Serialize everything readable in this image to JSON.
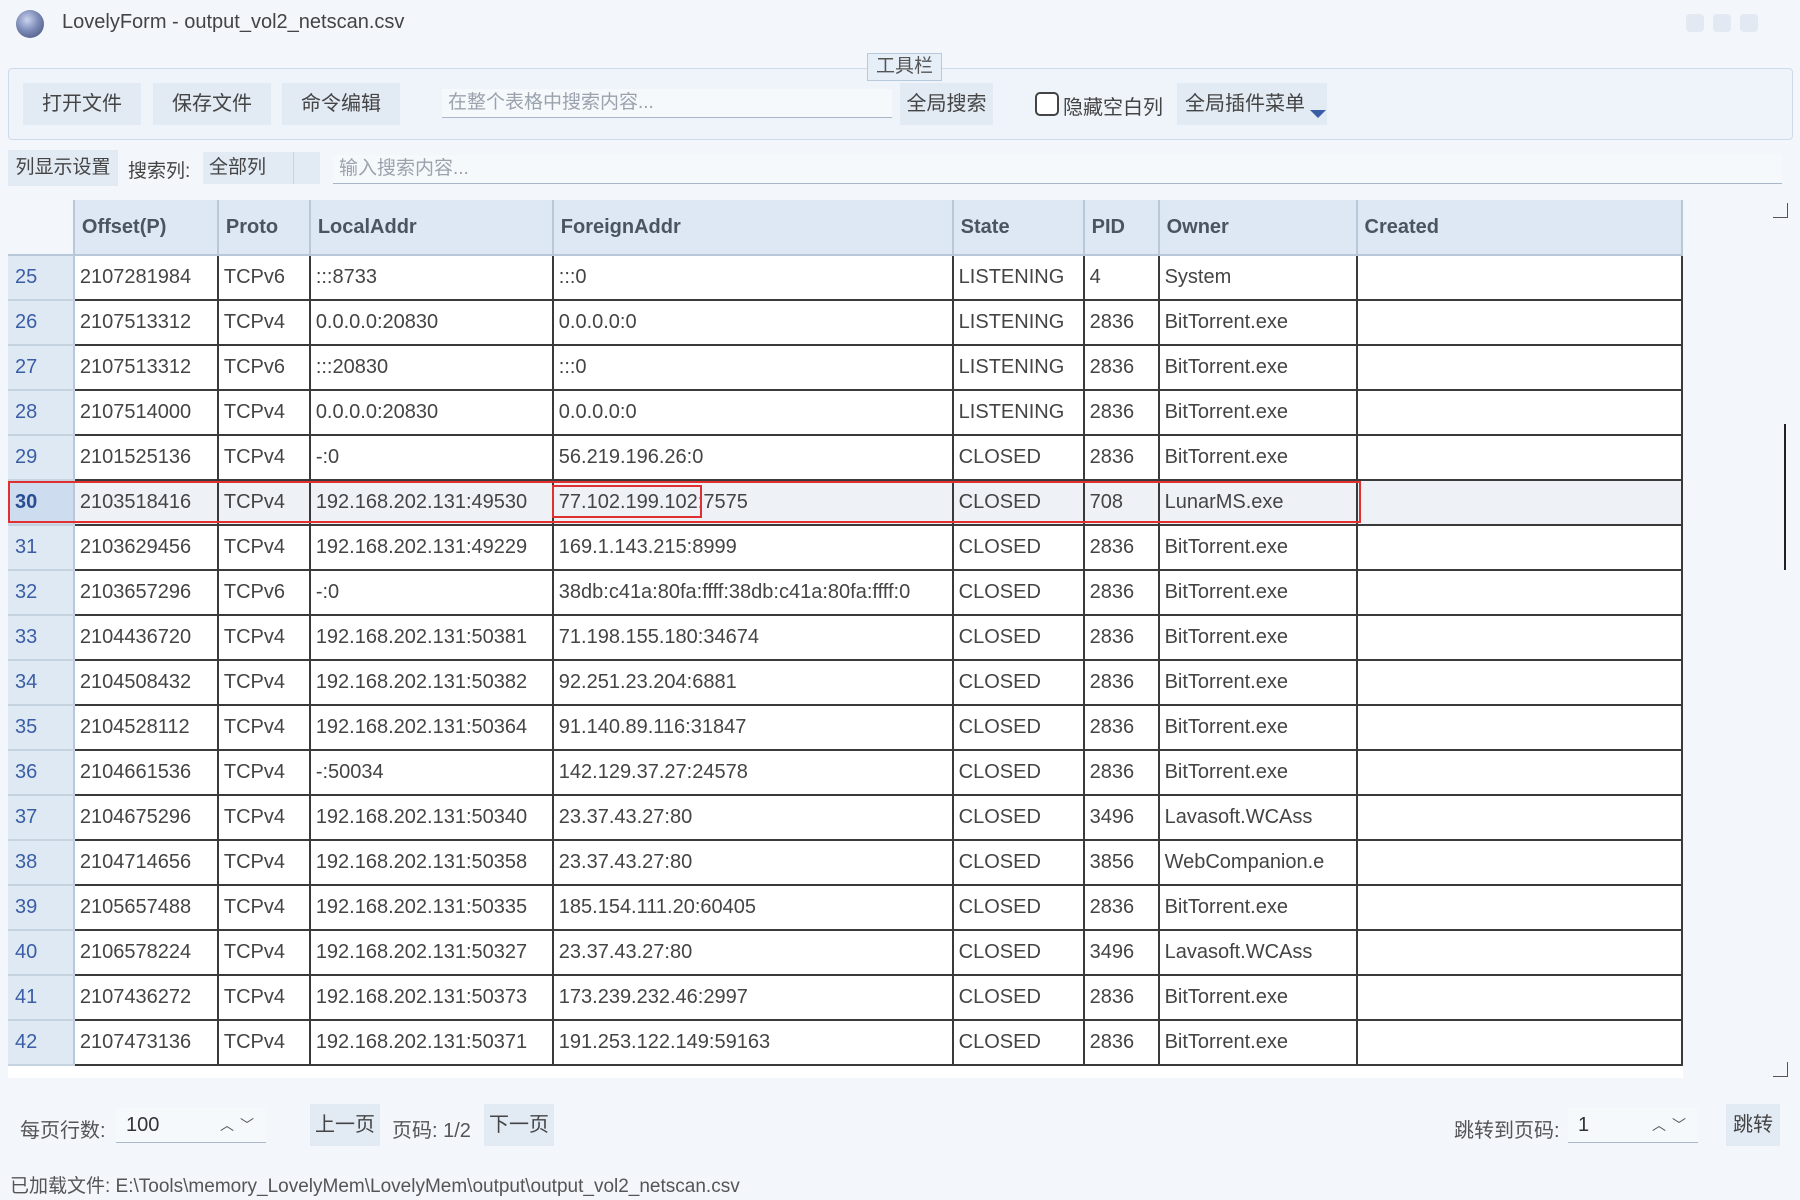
{
  "window": {
    "title": "LovelyForm - output_vol2_netscan.csv"
  },
  "toolbar": {
    "title": "工具栏",
    "open_file": "打开文件",
    "save_file": "保存文件",
    "command_edit": "命令编辑",
    "global_search_placeholder": "在整个表格中搜索内容...",
    "global_search": "全局搜索",
    "hide_empty_columns": "隐藏空白列",
    "hide_empty_checked": false,
    "plugin_menu": "全局插件菜单"
  },
  "search_bar": {
    "column_settings": "列显示设置",
    "search_column_label": "搜索列:",
    "search_column_value": "全部列",
    "search_placeholder": "输入搜索内容..."
  },
  "table": {
    "columns": [
      "Offset(P)",
      "Proto",
      "LocalAddr",
      "ForeignAddr",
      "State",
      "PID",
      "Owner",
      "Created"
    ],
    "selected_row": 30,
    "rows": [
      {
        "num": "25",
        "cells": [
          "2107281984",
          "TCPv6",
          ":::8733",
          ":::0",
          "LISTENING",
          "4",
          "System",
          ""
        ]
      },
      {
        "num": "26",
        "cells": [
          "2107513312",
          "TCPv4",
          "0.0.0.0:20830",
          "0.0.0.0:0",
          "LISTENING",
          "2836",
          "BitTorrent.exe",
          ""
        ]
      },
      {
        "num": "27",
        "cells": [
          "2107513312",
          "TCPv6",
          ":::20830",
          ":::0",
          "LISTENING",
          "2836",
          "BitTorrent.exe",
          ""
        ]
      },
      {
        "num": "28",
        "cells": [
          "2107514000",
          "TCPv4",
          "0.0.0.0:20830",
          "0.0.0.0:0",
          "LISTENING",
          "2836",
          "BitTorrent.exe",
          ""
        ]
      },
      {
        "num": "29",
        "cells": [
          "2101525136",
          "TCPv4",
          "-:0",
          "56.219.196.26:0",
          "CLOSED",
          "2836",
          "BitTorrent.exe",
          ""
        ]
      },
      {
        "num": "30",
        "cells": [
          "2103518416",
          "TCPv4",
          "192.168.202.131:49530",
          "77.102.199.102:7575",
          "CLOSED",
          "708",
          "LunarMS.exe",
          ""
        ]
      },
      {
        "num": "31",
        "cells": [
          "2103629456",
          "TCPv4",
          "192.168.202.131:49229",
          "169.1.143.215:8999",
          "CLOSED",
          "2836",
          "BitTorrent.exe",
          ""
        ]
      },
      {
        "num": "32",
        "cells": [
          "2103657296",
          "TCPv6",
          "-:0",
          "38db:c41a:80fa:ffff:38db:c41a:80fa:ffff:0",
          "CLOSED",
          "2836",
          "BitTorrent.exe",
          ""
        ]
      },
      {
        "num": "33",
        "cells": [
          "2104436720",
          "TCPv4",
          "192.168.202.131:50381",
          "71.198.155.180:34674",
          "CLOSED",
          "2836",
          "BitTorrent.exe",
          ""
        ]
      },
      {
        "num": "34",
        "cells": [
          "2104508432",
          "TCPv4",
          "192.168.202.131:50382",
          "92.251.23.204:6881",
          "CLOSED",
          "2836",
          "BitTorrent.exe",
          ""
        ]
      },
      {
        "num": "35",
        "cells": [
          "2104528112",
          "TCPv4",
          "192.168.202.131:50364",
          "91.140.89.116:31847",
          "CLOSED",
          "2836",
          "BitTorrent.exe",
          ""
        ]
      },
      {
        "num": "36",
        "cells": [
          "2104661536",
          "TCPv4",
          "-:50034",
          "142.129.37.27:24578",
          "CLOSED",
          "2836",
          "BitTorrent.exe",
          ""
        ]
      },
      {
        "num": "37",
        "cells": [
          "2104675296",
          "TCPv4",
          "192.168.202.131:50340",
          "23.37.43.27:80",
          "CLOSED",
          "3496",
          "Lavasoft.WCAss",
          ""
        ]
      },
      {
        "num": "38",
        "cells": [
          "2104714656",
          "TCPv4",
          "192.168.202.131:50358",
          "23.37.43.27:80",
          "CLOSED",
          "3856",
          "WebCompanion.e",
          ""
        ]
      },
      {
        "num": "39",
        "cells": [
          "2105657488",
          "TCPv4",
          "192.168.202.131:50335",
          "185.154.111.20:60405",
          "CLOSED",
          "2836",
          "BitTorrent.exe",
          ""
        ]
      },
      {
        "num": "40",
        "cells": [
          "2106578224",
          "TCPv4",
          "192.168.202.131:50327",
          "23.37.43.27:80",
          "CLOSED",
          "3496",
          "Lavasoft.WCAss",
          ""
        ]
      },
      {
        "num": "41",
        "cells": [
          "2107436272",
          "TCPv4",
          "192.168.202.131:50373",
          "173.239.232.46:2997",
          "CLOSED",
          "2836",
          "BitTorrent.exe",
          ""
        ]
      },
      {
        "num": "42",
        "cells": [
          "2107473136",
          "TCPv4",
          "192.168.202.131:50371",
          "191.253.122.149:59163",
          "CLOSED",
          "2836",
          "BitTorrent.exe",
          ""
        ]
      }
    ]
  },
  "pagination": {
    "rows_per_page_label": "每页行数:",
    "rows_per_page": "100",
    "prev_page": "上一页",
    "page_info": "页码: 1/2",
    "next_page": "下一页",
    "jump_label": "跳转到页码:",
    "jump_value": "1",
    "jump_button": "跳转"
  },
  "status_bar": {
    "text": "已加载文件: E:\\Tools\\memory_LovelyMem\\LovelyMem\\output\\output_vol2_netscan.csv"
  },
  "colors": {
    "highlight": "#e03030",
    "header_bg": "#dde8f4",
    "accent": "#3a5ea5"
  }
}
